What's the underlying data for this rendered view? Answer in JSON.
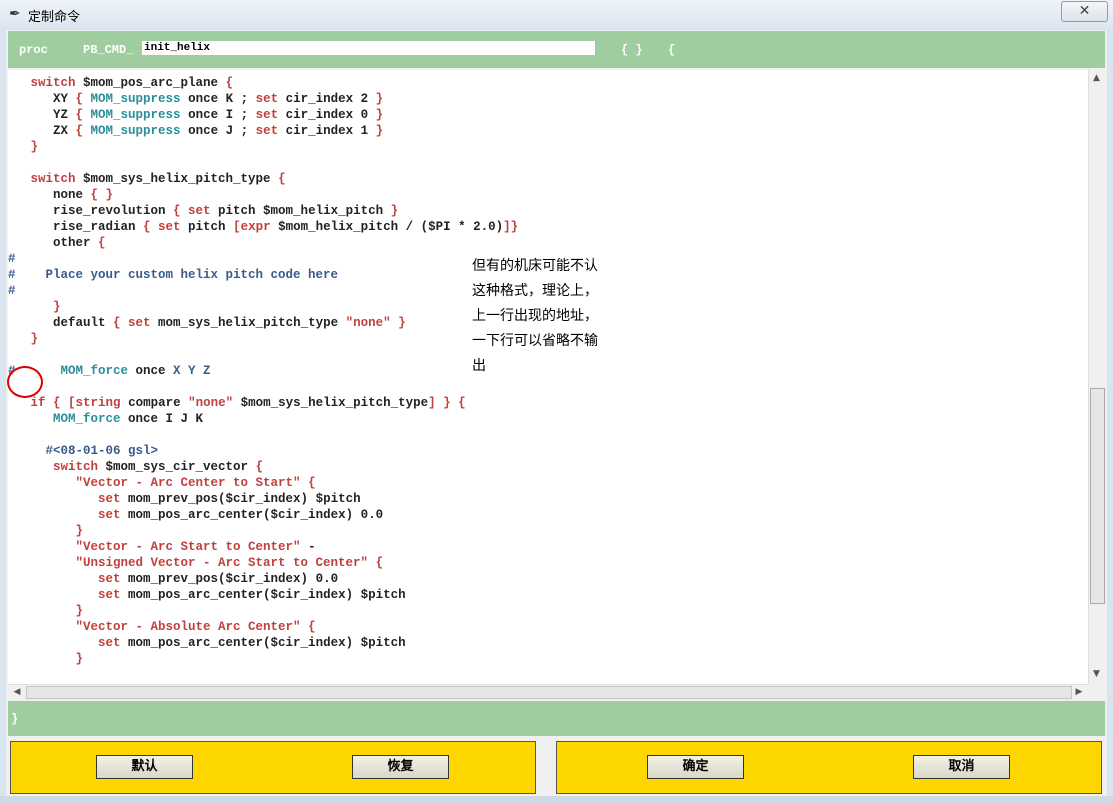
{
  "window": {
    "title": "定制命令",
    "close_glyph": "✕"
  },
  "header": {
    "proc_label": "proc",
    "prefix": "PB_CMD_",
    "command_name": "init_helix",
    "brace_pair": "{ }",
    "open_brace": "{"
  },
  "code_lines": [
    "",
    "   switch $mom_pos_arc_plane {",
    "      XY { MOM_suppress once K ; set cir_index 2 }",
    "      YZ { MOM_suppress once I ; set cir_index 0 }",
    "      ZX { MOM_suppress once J ; set cir_index 1 }",
    "   }",
    "",
    "   switch $mom_sys_helix_pitch_type {",
    "      none { }",
    "      rise_revolution { set pitch $mom_helix_pitch }",
    "      rise_radian { set pitch [expr $mom_helix_pitch / ($PI * 2.0)]}",
    "      other {",
    "#",
    "#    Place your custom helix pitch code here",
    "#",
    "      }",
    "      default { set mom_sys_helix_pitch_type \"none\" }",
    "   }",
    "",
    "#      MOM_force once X Y Z",
    "",
    "   if { [string compare \"none\" $mom_sys_helix_pitch_type] } {",
    "      MOM_force once I J K",
    "",
    "     #<08-01-06 gsl>",
    "      switch $mom_sys_cir_vector {",
    "         \"Vector - Arc Center to Start\" {",
    "            set mom_prev_pos($cir_index) $pitch",
    "            set mom_pos_arc_center($cir_index) 0.0",
    "         }",
    "         \"Vector - Arc Start to Center\" -",
    "         \"Unsigned Vector - Arc Start to Center\" {",
    "            set mom_prev_pos($cir_index) 0.0",
    "            set mom_pos_arc_center($cir_index) $pitch",
    "         }",
    "         \"Vector - Absolute Arc Center\" {",
    "            set mom_pos_arc_center($cir_index) $pitch",
    "         }"
  ],
  "annotation": {
    "lines": [
      "但有的机床可能不认",
      "这种格式，理论上，",
      "上一行出现的地址，",
      "一下行可以省略不输",
      "出"
    ]
  },
  "footer": {
    "closing_brace": "}"
  },
  "buttons": {
    "default_label": "默认",
    "restore_label": "恢复",
    "ok_label": "确定",
    "cancel_label": "取消"
  },
  "scroll": {
    "up": "▲",
    "down": "▼",
    "left": "◀",
    "right": "▶"
  },
  "colors": {
    "header_green": "#9fcd9f",
    "button_panel_yellow": "#ffd700",
    "keyword_red": "#c04040",
    "mom_teal": "#2a8f9a",
    "comment_blue": "#3a5a8a"
  }
}
